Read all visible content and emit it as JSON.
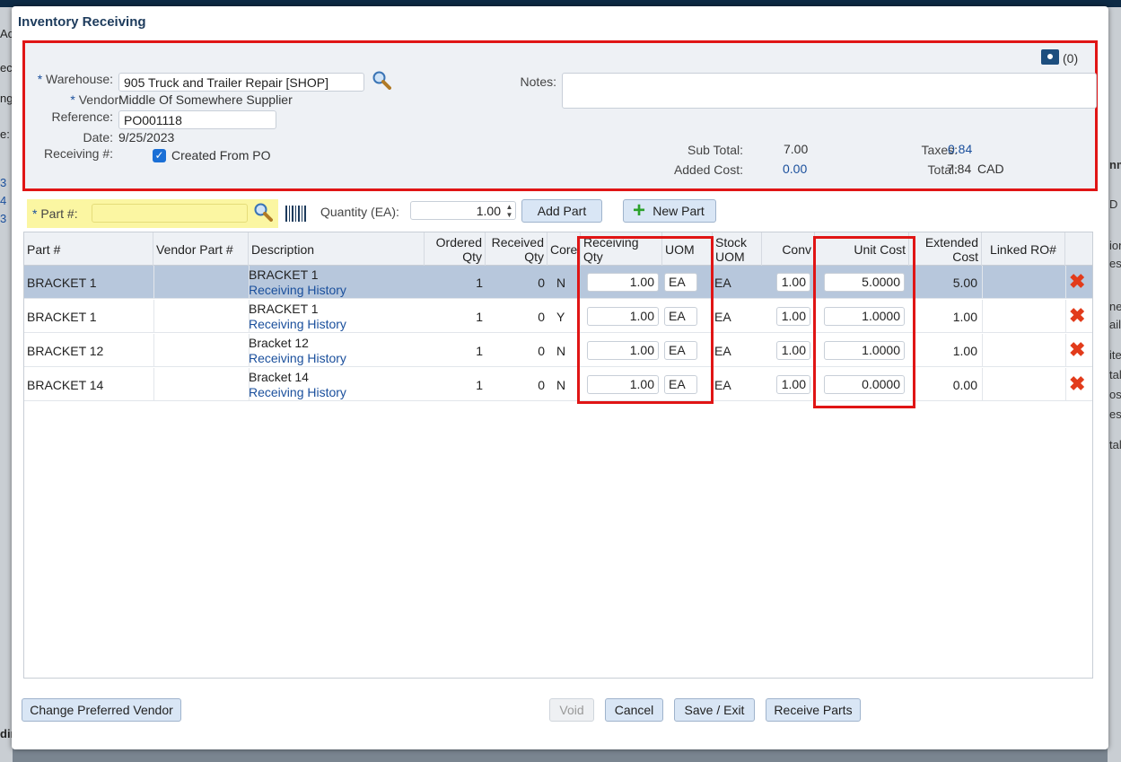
{
  "background": {
    "left_fragments": [
      "Ac",
      "ec",
      "ng",
      "e:",
      "3",
      "4",
      "3",
      "dir"
    ],
    "right_fragments": [
      "nm",
      "D",
      "ion",
      "ess",
      "ne",
      "ail",
      "ite",
      "tal",
      "ost",
      "es",
      "tal"
    ]
  },
  "dialog": {
    "title": "Inventory Receiving"
  },
  "header": {
    "warehouse_label": "Warehouse:",
    "warehouse_value": "905 Truck and Trailer Repair [SHOP]",
    "vendor_label": "Vendor:",
    "vendor_value": "Middle Of Somewhere Supplier",
    "reference_label": "Reference:",
    "reference_value": "PO001118",
    "date_label": "Date:",
    "date_value": "9/25/2023",
    "receiving_label": "Receiving #:",
    "created_from_po_label": "Created From PO",
    "notes_label": "Notes:",
    "notes_value": "",
    "attachments_count": "(0)",
    "subtotal_label": "Sub Total:",
    "subtotal_value": "7.00",
    "added_cost_label": "Added Cost:",
    "added_cost_value": "0.00",
    "taxes_label": "Taxes:",
    "taxes_value": "0.84",
    "total_label": "Total:",
    "total_value": "7.84",
    "currency": "CAD"
  },
  "toolbar": {
    "part_label": "Part #:",
    "part_value": "",
    "quantity_label": "Quantity (EA):",
    "quantity_value": "1.00",
    "add_part_label": "Add Part",
    "new_part_label": "New Part"
  },
  "grid": {
    "columns": {
      "part": "Part #",
      "vendor_part": "Vendor Part #",
      "description": "Description",
      "ordered_qty": "Ordered Qty",
      "received_qty": "Received Qty",
      "core": "Core",
      "receiving_qty": "Receiving Qty",
      "uom": "UOM",
      "stock_uom": "Stock UOM",
      "conv": "Conv",
      "unit_cost": "Unit Cost",
      "extended_cost": "Extended Cost",
      "linked_ro": "Linked RO#"
    },
    "rows": [
      {
        "part": "BRACKET 1",
        "vendor_part": "",
        "description": "BRACKET 1",
        "history": "Receiving History",
        "ordered": "1",
        "received": "0",
        "core": "N",
        "receiving_qty": "1.00",
        "uom": "EA",
        "stock_uom": "EA",
        "conv": "1.00",
        "unit_cost": "5.0000",
        "extended": "5.00",
        "linked_ro": ""
      },
      {
        "part": "BRACKET 1",
        "vendor_part": "",
        "description": "BRACKET 1",
        "history": "Receiving History",
        "ordered": "1",
        "received": "0",
        "core": "Y",
        "receiving_qty": "1.00",
        "uom": "EA",
        "stock_uom": "EA",
        "conv": "1.00",
        "unit_cost": "1.0000",
        "extended": "1.00",
        "linked_ro": ""
      },
      {
        "part": "BRACKET 12",
        "vendor_part": "",
        "description": "Bracket 12",
        "history": "Receiving History",
        "ordered": "1",
        "received": "0",
        "core": "N",
        "receiving_qty": "1.00",
        "uom": "EA",
        "stock_uom": "EA",
        "conv": "1.00",
        "unit_cost": "1.0000",
        "extended": "1.00",
        "linked_ro": ""
      },
      {
        "part": "BRACKET 14",
        "vendor_part": "",
        "description": "Bracket 14",
        "history": "Receiving History",
        "ordered": "1",
        "received": "0",
        "core": "N",
        "receiving_qty": "1.00",
        "uom": "EA",
        "stock_uom": "EA",
        "conv": "1.00",
        "unit_cost": "0.0000",
        "extended": "0.00",
        "linked_ro": ""
      }
    ]
  },
  "footer": {
    "change_vendor_label": "Change Preferred Vendor",
    "void_label": "Void",
    "cancel_label": "Cancel",
    "save_exit_label": "Save / Exit",
    "receive_parts_label": "Receive Parts"
  },
  "colors": {
    "highlight_border": "#e01515",
    "link": "#1a4f9c",
    "selected_row": "#b7c7dc",
    "part_field_bg": "#fbf6a2"
  }
}
